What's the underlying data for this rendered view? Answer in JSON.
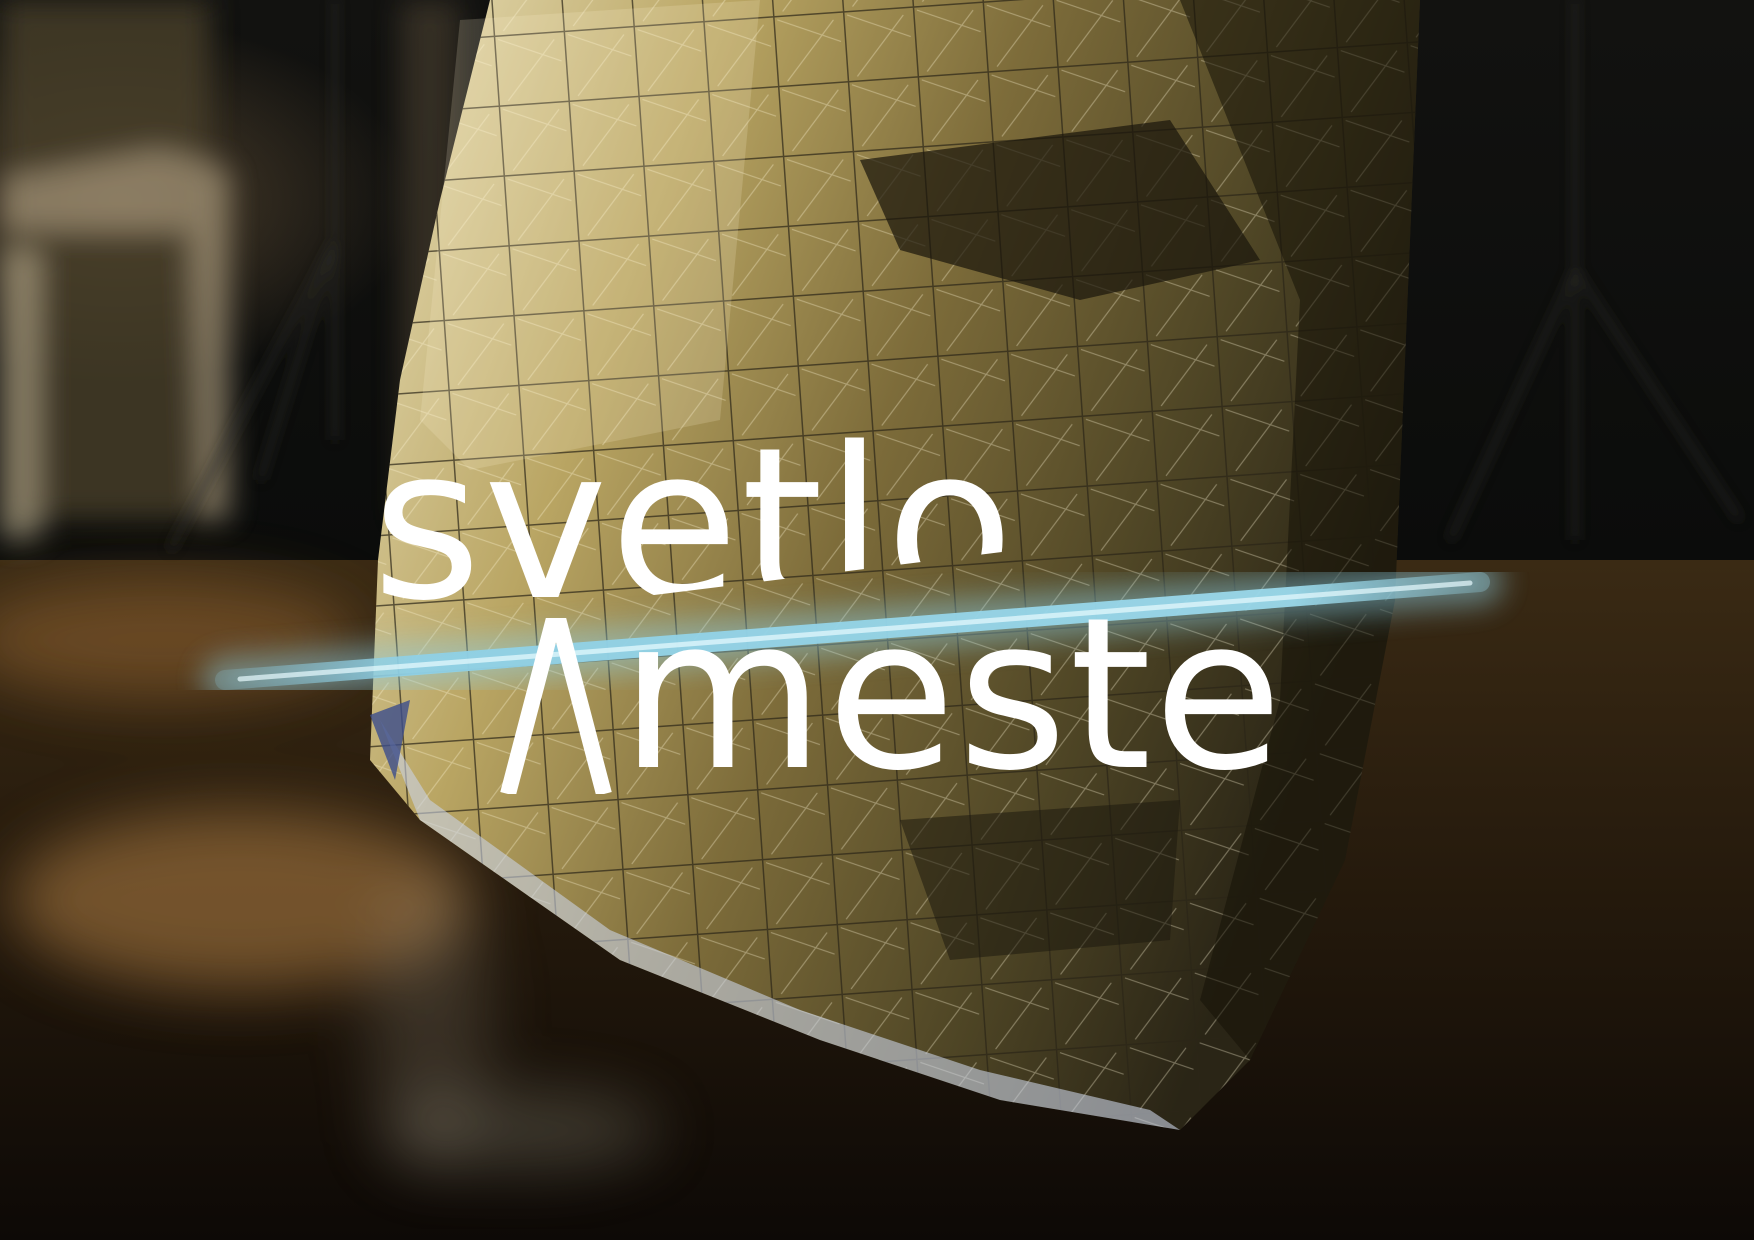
{
  "image": {
    "kind": "photo-poster",
    "palette": {
      "background": "#07090a",
      "foil_gold": "#b8a566",
      "foil_highlight": "#f2ead0",
      "floor_amber": "#8a5a28",
      "light_beam": "#8fd0e6",
      "wordmark": "#ffffff"
    }
  },
  "wordmark": {
    "line1": "svetlo",
    "line2": "meste",
    "a_glyph": "Λ"
  }
}
